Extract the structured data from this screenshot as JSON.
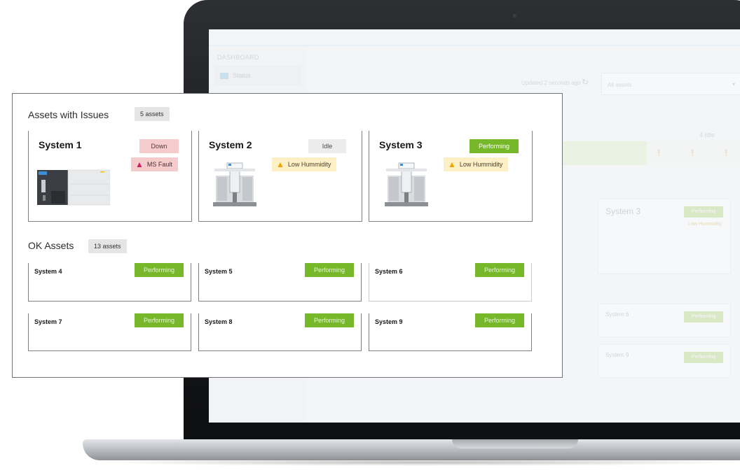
{
  "background_app": {
    "nav_section": "DASHBOARD",
    "nav_status": "Status",
    "updated_text": "Updated 2 seconds ago",
    "filter_value": "All assets",
    "idle_count": "4 Idle",
    "card_system3": "System 3",
    "card_performing": "Performing",
    "card_humidity": "Low Hummidity",
    "card_system6": "System 6",
    "card_system9": "System 9"
  },
  "issues": {
    "title": "Assets with Issues",
    "count": "5 assets",
    "cards": [
      {
        "name": "System 1",
        "status": "Down",
        "alert": "MS Fault"
      },
      {
        "name": "System 2",
        "status": "Idle",
        "alert": "Low Hummidity"
      },
      {
        "name": "System 3",
        "status": "Performing",
        "alert": "Low Hummidity"
      }
    ]
  },
  "ok": {
    "title": "OK Assets",
    "count": "13 assets",
    "cards": [
      {
        "name": "System 4",
        "status": "Performing"
      },
      {
        "name": "System 5",
        "status": "Performing"
      },
      {
        "name": "System 6",
        "status": "Performing"
      },
      {
        "name": "System 7",
        "status": "Performing"
      },
      {
        "name": "System 8",
        "status": "Performing"
      },
      {
        "name": "System 9",
        "status": "Performing"
      }
    ]
  },
  "colors": {
    "performing": "#76b82a",
    "down": "#f5cbcc",
    "idle": "#ececec",
    "humidity_alert": "#fdf0c6",
    "fault_icon": "#d0215f",
    "warning_icon": "#efa500"
  }
}
